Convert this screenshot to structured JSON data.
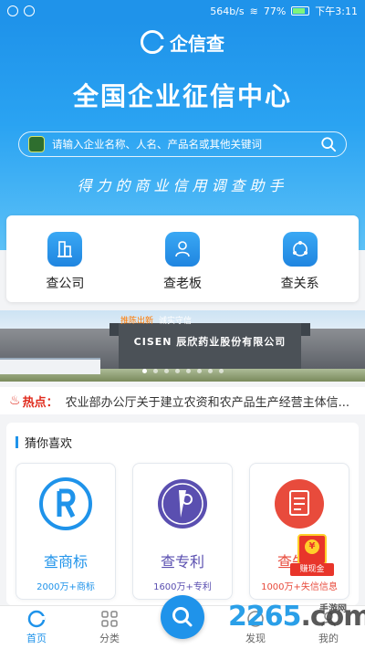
{
  "status_bar": {
    "speed": "564b/s",
    "battery": "77%",
    "time": "下午3:11"
  },
  "app": {
    "title": "企信查"
  },
  "hero": {
    "headline": "全国企业征信中心",
    "search_placeholder": "请输入企业名称、人名、产品名或其他关键词",
    "slogan": "得力的商业信用调查助手"
  },
  "quick_actions": [
    {
      "label": "查公司",
      "icon": "building-icon"
    },
    {
      "label": "查老板",
      "icon": "person-icon"
    },
    {
      "label": "查关系",
      "icon": "network-icon"
    }
  ],
  "banner": {
    "tag_red": "推陈出新",
    "tag_white": "诚实守信",
    "company": "CISEN 辰欣药业股份有限公司",
    "slide_count": 8,
    "active_slide": 0
  },
  "hot": {
    "label": "热点：",
    "text": "农业部办公厅关于建立农资和农产品生产经营主体信..."
  },
  "guess": {
    "title": "猜你喜欢",
    "cards": [
      {
        "title": "查商标",
        "subtitle": "2000万+商标",
        "color": "#1f93ea",
        "icon": "trademark-icon"
      },
      {
        "title": "查专利",
        "subtitle": "1600万+专利",
        "color": "#5a4fb0",
        "icon": "patent-icon"
      },
      {
        "title": "查失信",
        "subtitle": "1000万+失信信息",
        "color": "#e84b3c",
        "icon": "document-icon"
      }
    ]
  },
  "red_packet": {
    "label": "赚现金",
    "symbol": "¥"
  },
  "tabs": [
    {
      "label": "首页",
      "active": true
    },
    {
      "label": "分类",
      "active": false
    },
    {
      "label": "",
      "active": false
    },
    {
      "label": "发现",
      "active": false
    },
    {
      "label": "我的",
      "active": false
    }
  ],
  "watermark": {
    "brand_num": "2265",
    "brand_dom": ".com",
    "site_name": "手游网"
  },
  "colors": {
    "primary": "#1f93ea",
    "hot_red": "#e02b1d"
  }
}
